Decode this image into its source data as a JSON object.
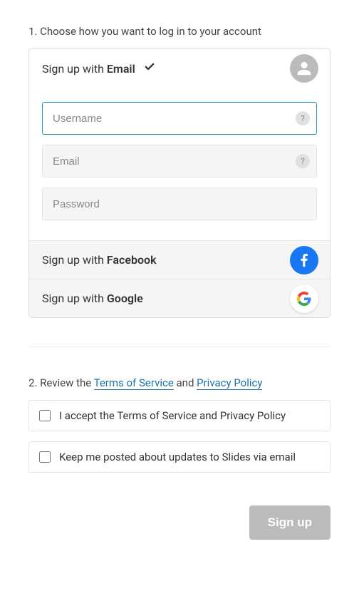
{
  "step1": {
    "label": "1. Choose how you want to log in to your account"
  },
  "providers": {
    "email": {
      "prefix": "Sign up with ",
      "name": "Email"
    },
    "facebook": {
      "prefix": "Sign up with ",
      "name": "Facebook"
    },
    "google": {
      "prefix": "Sign up with ",
      "name": "Google"
    }
  },
  "form": {
    "username": {
      "placeholder": "Username",
      "value": ""
    },
    "email": {
      "placeholder": "Email",
      "value": ""
    },
    "password": {
      "placeholder": "Password",
      "value": ""
    },
    "help": "?"
  },
  "step2": {
    "prefix": "2. Review the ",
    "tos": "Terms of Service",
    "and": " and ",
    "privacy": "Privacy Policy"
  },
  "checks": {
    "accept": "I accept the Terms of Service and Privacy Policy",
    "updates": "Keep me posted about updates to Slides via email"
  },
  "submit": "Sign up"
}
